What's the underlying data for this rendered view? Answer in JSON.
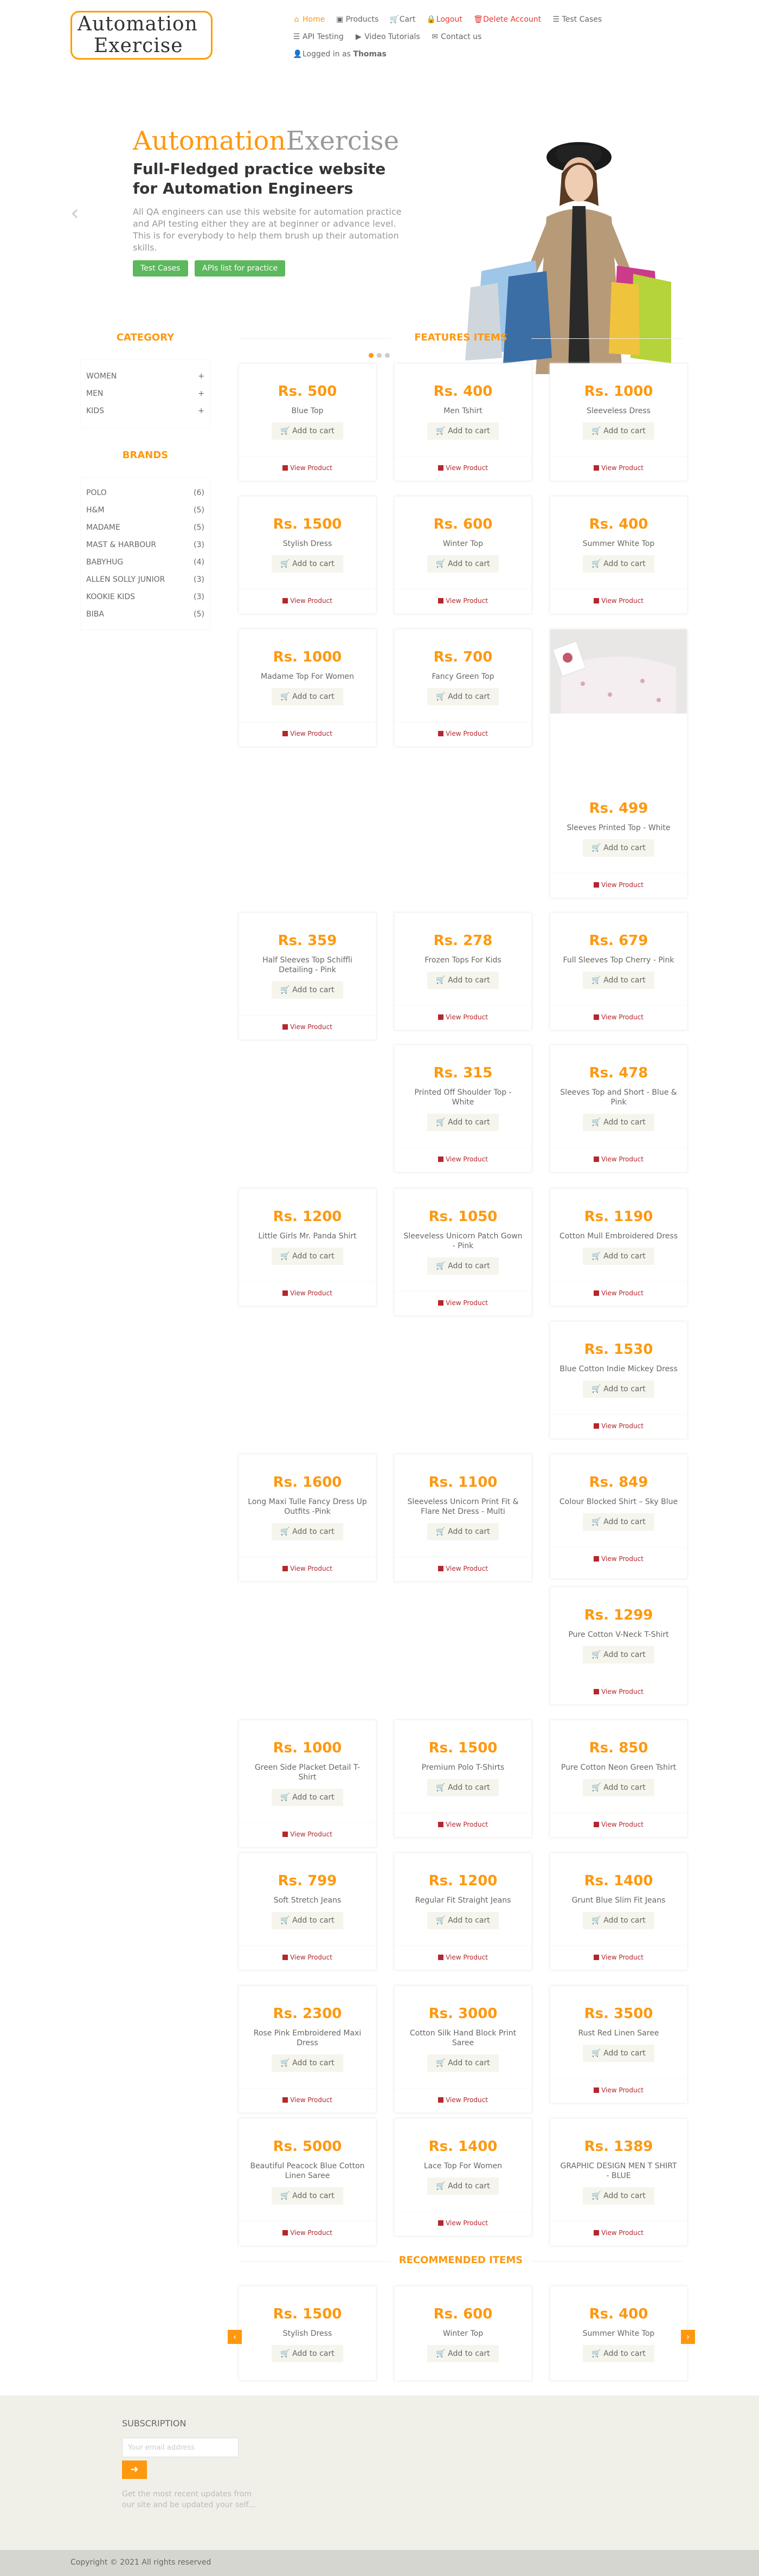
{
  "header": {
    "logo_line1": "Automation",
    "logo_line2": "Exercise",
    "nav": [
      {
        "label": "Home",
        "icon": "home-icon"
      },
      {
        "label": "Products",
        "icon": "products-icon"
      },
      {
        "label": "Cart",
        "icon": "cart-icon"
      },
      {
        "label": "Logout",
        "icon": "lock-icon"
      },
      {
        "label": "Delete Account",
        "icon": "trash-icon"
      },
      {
        "label": "Test Cases",
        "icon": "list-icon"
      },
      {
        "label": "API Testing",
        "icon": "list-icon"
      },
      {
        "label": "Video Tutorials",
        "icon": "youtube-icon"
      },
      {
        "label": "Contact us",
        "icon": "envelope-icon"
      }
    ],
    "logged_in_prefix": "Logged in as",
    "logged_in_user": "Thomas"
  },
  "slider": {
    "brand_a": "Automation",
    "brand_b": "Exercise",
    "heading": "Full-Fledged practice website for Automation Engineers",
    "text": "All QA engineers can use this website for automation practice and API testing either they are at beginner or advance level. This is for everybody to help them brush up their automation skills.",
    "btn1": "Test Cases",
    "btn2": "APIs list for practice",
    "prev": "‹",
    "next": "›"
  },
  "sidebar": {
    "category_title": "CATEGORY",
    "categories": [
      "WOMEN",
      "MEN",
      "KIDS"
    ],
    "brands_title": "BRANDS",
    "brands": [
      {
        "name": "POLO",
        "count": "(6)"
      },
      {
        "name": "H&M",
        "count": "(5)"
      },
      {
        "name": "MADAME",
        "count": "(5)"
      },
      {
        "name": "MAST & HARBOUR",
        "count": "(3)"
      },
      {
        "name": "BABYHUG",
        "count": "(4)"
      },
      {
        "name": "ALLEN SOLLY JUNIOR",
        "count": "(3)"
      },
      {
        "name": "KOOKIE KIDS",
        "count": "(3)"
      },
      {
        "name": "BIBA",
        "count": "(5)"
      }
    ]
  },
  "features_title": "FEATURES ITEMS",
  "recommended_title": "RECOMMENDED ITEMS",
  "labels": {
    "add_to_cart": "Add to cart",
    "view_product": "View Product"
  },
  "products": [
    {
      "price": "Rs. 500",
      "name": "Blue Top"
    },
    {
      "price": "Rs. 400",
      "name": "Men Tshirt"
    },
    {
      "price": "Rs. 1000",
      "name": "Sleeveless Dress"
    },
    {
      "price": "Rs. 1500",
      "name": "Stylish Dress"
    },
    {
      "price": "Rs. 600",
      "name": "Winter Top"
    },
    {
      "price": "Rs. 400",
      "name": "Summer White Top"
    },
    {
      "price": "Rs. 1000",
      "name": "Madame Top For Women"
    },
    {
      "price": "Rs. 700",
      "name": "Fancy Green Top"
    },
    {
      "price": "Rs. 499",
      "name": "Sleeves Printed Top - White"
    },
    {
      "price": "Rs. 359",
      "name": "Half Sleeves Top Schiffli Detailing - Pink"
    },
    {
      "price": "Rs. 278",
      "name": "Frozen Tops For Kids"
    },
    {
      "price": "Rs. 679",
      "name": "Full Sleeves Top Cherry - Pink"
    },
    {
      "price": "Rs. 315",
      "name": "Printed Off Shoulder Top - White"
    },
    {
      "price": "Rs. 478",
      "name": "Sleeves Top and Short - Blue & Pink"
    },
    {
      "price": "Rs. 1200",
      "name": "Little Girls Mr. Panda Shirt"
    },
    {
      "price": "Rs. 1050",
      "name": "Sleeveless Unicorn Patch Gown - Pink"
    },
    {
      "price": "Rs. 1190",
      "name": "Cotton Mull Embroidered Dress"
    },
    {
      "price": "Rs. 1530",
      "name": "Blue Cotton Indie Mickey Dress"
    },
    {
      "price": "Rs. 1600",
      "name": "Long Maxi Tulle Fancy Dress Up Outfits -Pink"
    },
    {
      "price": "Rs. 1100",
      "name": "Sleeveless Unicorn Print Fit & Flare Net Dress - Multi"
    },
    {
      "price": "Rs. 849",
      "name": "Colour Blocked Shirt – Sky Blue"
    },
    {
      "price": "Rs. 1299",
      "name": "Pure Cotton V-Neck T-Shirt"
    },
    {
      "price": "Rs. 1000",
      "name": "Green Side Placket Detail T-Shirt"
    },
    {
      "price": "Rs. 1500",
      "name": "Premium Polo T-Shirts"
    },
    {
      "price": "Rs. 850",
      "name": "Pure Cotton Neon Green Tshirt"
    },
    {
      "price": "Rs. 799",
      "name": "Soft Stretch Jeans"
    },
    {
      "price": "Rs. 1200",
      "name": "Regular Fit Straight Jeans"
    },
    {
      "price": "Rs. 1400",
      "name": "Grunt Blue Slim Fit Jeans"
    },
    {
      "price": "Rs. 2300",
      "name": "Rose Pink Embroidered Maxi Dress"
    },
    {
      "price": "Rs. 3000",
      "name": "Cotton Silk Hand Block Print Saree"
    },
    {
      "price": "Rs. 3500",
      "name": "Rust Red Linen Saree"
    },
    {
      "price": "Rs. 5000",
      "name": "Beautiful Peacock Blue Cotton Linen Saree"
    },
    {
      "price": "Rs. 1400",
      "name": "Lace Top For Women"
    },
    {
      "price": "Rs. 1389",
      "name": "GRAPHIC DESIGN MEN T SHIRT - BLUE"
    }
  ],
  "recommended": [
    {
      "price": "Rs. 1500",
      "name": "Stylish Dress"
    },
    {
      "price": "Rs. 600",
      "name": "Winter Top"
    },
    {
      "price": "Rs. 400",
      "name": "Summer White Top"
    }
  ],
  "footer": {
    "subscription_title": "SUBSCRIPTION",
    "email_placeholder": "Your email address",
    "note": "Get the most recent updates from our site and be updated your self...",
    "copyright": "Copyright © 2021 All rights reserved"
  },
  "colors": {
    "accent": "#fe980f",
    "link_red": "#b4272d",
    "green": "#5cb85c",
    "footer_bg": "#f0f0e9"
  }
}
